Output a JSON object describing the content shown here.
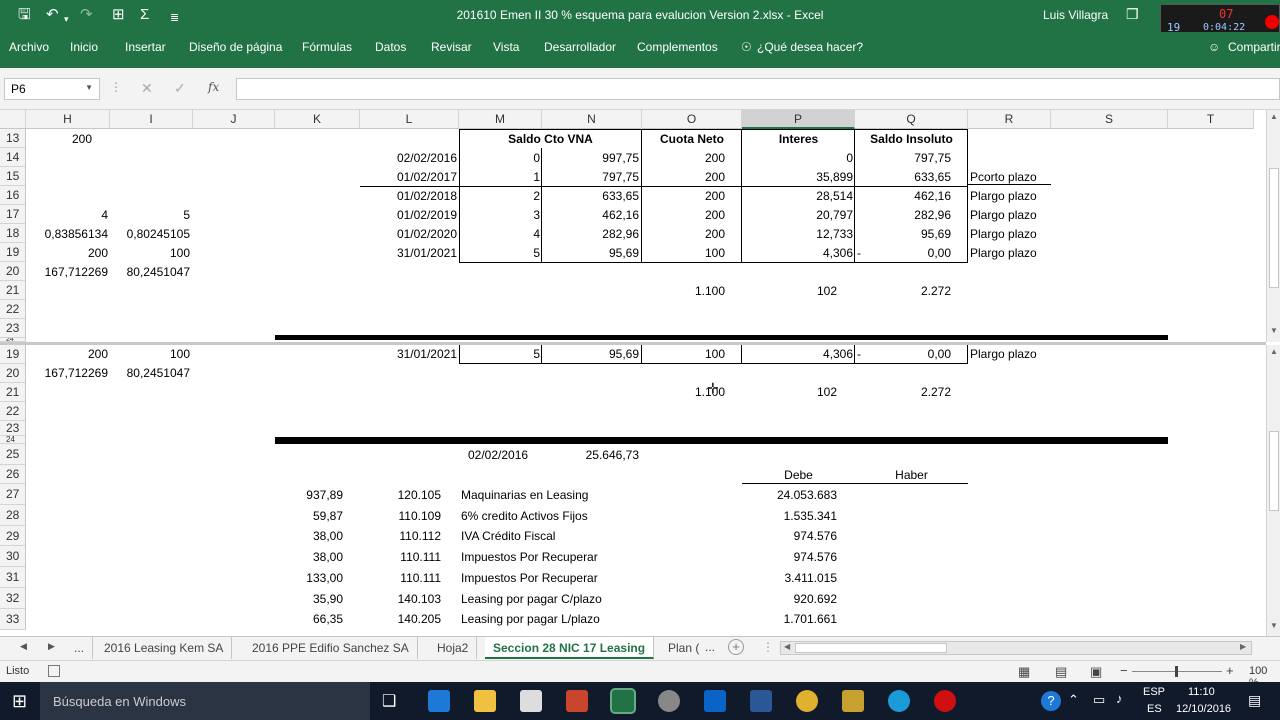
{
  "window": {
    "title": "201610 Emen II  30 %  esquema para evalucion Version 2.xlsx - Excel",
    "user": "Luis Villagra",
    "counter": "07",
    "clock_small": "19",
    "clock": "0:04:22"
  },
  "ribbon": {
    "tabs": [
      "Archivo",
      "Inicio",
      "Insertar",
      "Diseño de página",
      "Fórmulas",
      "Datos",
      "Revisar",
      "Vista",
      "Desarrollador",
      "Complementos"
    ],
    "tellme": "¿Qué desea hacer?",
    "share": "Compartir"
  },
  "formula": {
    "namebox": "P6",
    "value": ""
  },
  "columns": [
    "H",
    "I",
    "J",
    "K",
    "L",
    "M",
    "N",
    "O",
    "P",
    "Q",
    "R",
    "S",
    "T"
  ],
  "pane1": {
    "rows": [
      "13",
      "14",
      "15",
      "16",
      "17",
      "18",
      "19",
      "20",
      "21",
      "22",
      "23",
      "24"
    ],
    "headers": {
      "m": "Saldo Cto VNA",
      "o": "Cuota Neto",
      "p": "Interes",
      "q": "Saldo Insoluto"
    },
    "h13": "200",
    "table": [
      {
        "date": "02/02/2016",
        "n": "0",
        "vna": "997,75",
        "cuota": "200",
        "interes": "0",
        "saldo": "797,75",
        "plazo": ""
      },
      {
        "date": "01/02/2017",
        "n": "1",
        "vna": "797,75",
        "cuota": "200",
        "interes": "35,899",
        "saldo": "633,65",
        "plazo": "Pcorto plazo"
      },
      {
        "date": "01/02/2018",
        "n": "2",
        "vna": "633,65",
        "cuota": "200",
        "interes": "28,514",
        "saldo": "462,16",
        "plazo": "Plargo plazo"
      },
      {
        "date": "01/02/2019",
        "n": "3",
        "vna": "462,16",
        "cuota": "200",
        "interes": "20,797",
        "saldo": "282,96",
        "plazo": "Plargo plazo"
      },
      {
        "date": "01/02/2020",
        "n": "4",
        "vna": "282,96",
        "cuota": "200",
        "interes": "12,733",
        "saldo": "95,69",
        "plazo": "Plargo plazo"
      },
      {
        "date": "31/01/2021",
        "n": "5",
        "vna": "95,69",
        "cuota": "100",
        "interes": "4,306",
        "saldo": "0,00",
        "plazo": "Plargo plazo",
        "dash": "-"
      }
    ],
    "h17": "4",
    "i17": "5",
    "h18": "0,83856134",
    "i18": "0,80245105",
    "h19": "200",
    "i19": "100",
    "h20": "167,712269",
    "i20": "80,2451047",
    "totals": {
      "cuota": "1.100",
      "interes": "102",
      "saldo": "2.272"
    }
  },
  "pane2": {
    "rows": [
      "19",
      "20",
      "21",
      "22",
      "23",
      "24",
      "25",
      "26",
      "27",
      "28",
      "29",
      "30",
      "31",
      "32",
      "33"
    ],
    "r19": {
      "h": "200",
      "i": "100",
      "date": "31/01/2021",
      "n": "5",
      "vna": "95,69",
      "cuota": "100",
      "interes": "4,306",
      "dash": "-",
      "saldo": "0,00",
      "plazo": "Plargo plazo"
    },
    "r20": {
      "h": "167,712269",
      "i": "80,2451047"
    },
    "totals": {
      "cuota": "1.100",
      "interes": "102",
      "saldo": "2.272"
    },
    "r25": {
      "date": "02/02/2016",
      "amount": "25.646,73"
    },
    "debe": "Debe",
    "haber": "Haber",
    "entries": [
      {
        "k": "937,89",
        "code": "120.105",
        "desc": "Maquinarias en Leasing",
        "debe": "24.053.683"
      },
      {
        "k": "59,87",
        "code": "110.109",
        "desc": "6% credito Activos Fijos",
        "debe": "1.535.341"
      },
      {
        "k": "38,00",
        "code": "110.112",
        "desc": "IVA Crédito Fiscal",
        "debe": "974.576"
      },
      {
        "k": "38,00",
        "code": "110.111",
        "desc": "Impuestos Por Recuperar",
        "debe": "974.576"
      },
      {
        "k": "133,00",
        "code": "110.111",
        "desc": "Impuestos Por Recuperar",
        "debe": "3.411.015"
      },
      {
        "k": "35,90",
        "code": "140.103",
        "desc": "Leasing por pagar C/plazo",
        "debe": "920.692"
      },
      {
        "k": "66,35",
        "code": "140.205",
        "desc": "Leasing por pagar L/plazo",
        "debe": "1.701.661"
      }
    ]
  },
  "sheets": {
    "more": "...",
    "tabs": [
      "2016 Leasing Kem SA",
      "2016  PPE Edifio  Sanchez SA",
      "Hoja2",
      "Seccion 28 NIC 17 Leasing",
      "Plan ("
    ],
    "active_index": 3,
    "after": "..."
  },
  "status": {
    "left": "Listo",
    "zoom": "100 %"
  },
  "taskbar": {
    "search": "Búsqueda en Windows",
    "lang1": "ESP",
    "lang2": "ES",
    "time": "11:10",
    "date": "12/10/2016"
  }
}
